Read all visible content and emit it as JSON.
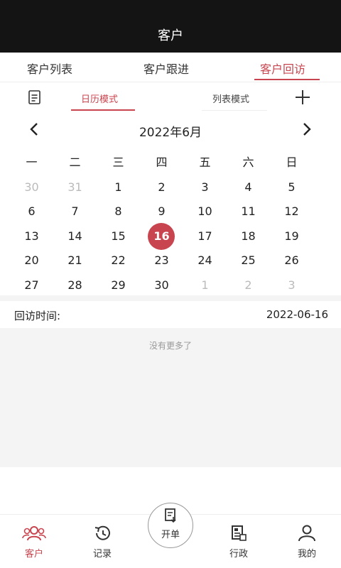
{
  "header": {
    "title": "客户"
  },
  "tabs": [
    {
      "label": "客户列表"
    },
    {
      "label": "客户跟进"
    },
    {
      "label": "客户回访"
    }
  ],
  "modes": {
    "calendar": "日历模式",
    "list": "列表模式"
  },
  "calendar": {
    "month_title": "2022年6月",
    "weekdays": [
      "一",
      "二",
      "三",
      "四",
      "五",
      "六",
      "日"
    ],
    "selected": "16",
    "weeks": [
      [
        {
          "d": "30",
          "m": true
        },
        {
          "d": "31",
          "m": true
        },
        {
          "d": "1"
        },
        {
          "d": "2"
        },
        {
          "d": "3"
        },
        {
          "d": "4"
        },
        {
          "d": "5"
        }
      ],
      [
        {
          "d": "6"
        },
        {
          "d": "7"
        },
        {
          "d": "8"
        },
        {
          "d": "9"
        },
        {
          "d": "10"
        },
        {
          "d": "11"
        },
        {
          "d": "12"
        }
      ],
      [
        {
          "d": "13"
        },
        {
          "d": "14"
        },
        {
          "d": "15"
        },
        {
          "d": "16",
          "s": true
        },
        {
          "d": "17"
        },
        {
          "d": "18"
        },
        {
          "d": "19"
        }
      ],
      [
        {
          "d": "20"
        },
        {
          "d": "21"
        },
        {
          "d": "22"
        },
        {
          "d": "23"
        },
        {
          "d": "24"
        },
        {
          "d": "25"
        },
        {
          "d": "26"
        }
      ],
      [
        {
          "d": "27"
        },
        {
          "d": "28"
        },
        {
          "d": "29"
        },
        {
          "d": "30"
        },
        {
          "d": "1",
          "m": true
        },
        {
          "d": "2",
          "m": true
        },
        {
          "d": "3",
          "m": true
        }
      ]
    ]
  },
  "visit": {
    "label": "回访时间:",
    "date": "2022-06-16"
  },
  "empty": {
    "text": "没有更多了"
  },
  "nav": {
    "customer": "客户",
    "records": "记录",
    "open_order": "开单",
    "admin": "行政",
    "mine": "我的"
  },
  "colors": {
    "accent": "#c8454f",
    "header_bg": "#141414"
  },
  "icons": {
    "doc": "doc-icon",
    "plus": "plus-icon",
    "prev": "chevron-left-icon",
    "next": "chevron-right-icon"
  }
}
